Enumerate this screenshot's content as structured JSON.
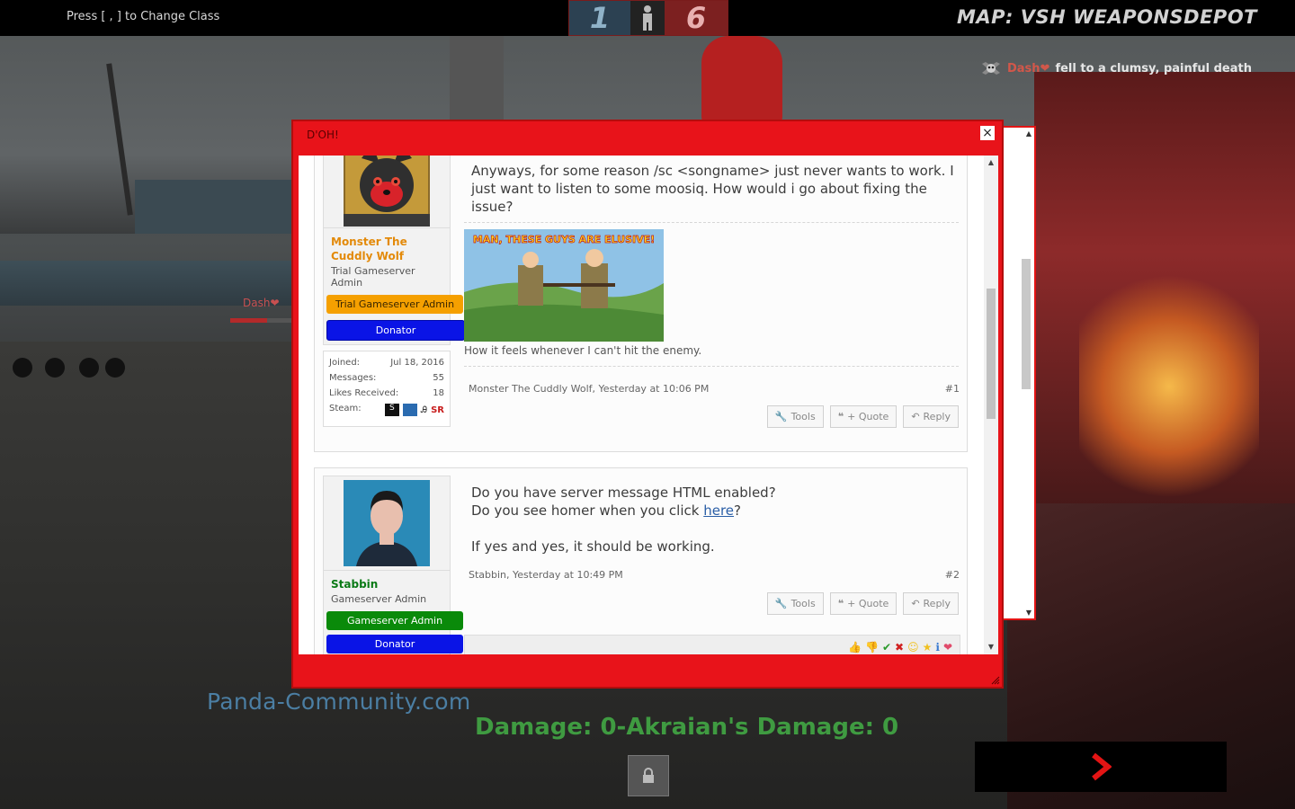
{
  "hud": {
    "hint": "Press [ , ] to Change Class",
    "score_blu": "1",
    "score_red": "6",
    "map": "MAP: VSH WEAPONSDEPOT",
    "killfeed": {
      "killer": "Dash",
      "message": "fell to a clumsy, painful death"
    },
    "player_tag": "Dash",
    "player_hp_fraction": 0.6,
    "watermark": "Panda-Community.com",
    "damage": "Damage: 0-Akraian's Damage: 0"
  },
  "dialog": {
    "title": "D'OH!",
    "close": "×"
  },
  "posts": [
    {
      "author": "Monster The Cuddly Wolf",
      "user_title": "Trial Gameserver Admin",
      "banners": [
        "Trial Gameserver Admin",
        "Donator"
      ],
      "stats": [
        {
          "label": "Joined:",
          "value": "Jul 18, 2016"
        },
        {
          "label": "Messages:",
          "value": "55"
        },
        {
          "label": "Likes Received:",
          "value": "18"
        },
        {
          "label": "Steam:",
          "value": "SR"
        }
      ],
      "message_lines": [
        "Anyways, for some reason /sc <songname> just never wants to work. I",
        "just want to listen to some moosiq. How would i go about fixing the",
        "issue?"
      ],
      "image_text": "MAN, THESE GUYS ARE ELUSIVE!",
      "caption": "How it feels whenever I can't hit the enemy.",
      "meta": "Monster The Cuddly Wolf, Yesterday at 10:06 PM",
      "number": "#1"
    },
    {
      "author": "Stabbin",
      "user_title": "Gameserver Admin",
      "banners": [
        "Gameserver Admin",
        "Donator"
      ],
      "message_lines": [
        "Do you have server message HTML enabled?",
        "Do you see homer when you click",
        "here",
        "?",
        "If yes and yes, it should be working."
      ],
      "meta": "Stabbin, Yesterday at 10:49 PM",
      "number": "#2"
    }
  ],
  "controls": {
    "tools": "Tools",
    "quote": "+ Quote",
    "reply": "Reply"
  },
  "colors": {
    "dialog_red": "#e8131a",
    "admin_orange": "#f5a000",
    "donator_blue": "#0a14e6",
    "gsadmin_green": "#0a8a0a",
    "name_orange": "#e38a0a",
    "name_green": "#0a7a16"
  }
}
